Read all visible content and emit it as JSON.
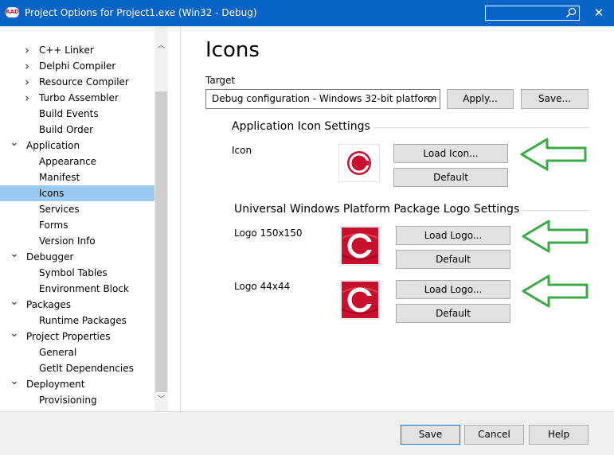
{
  "window": {
    "title": "Project Options for Project1.exe  (Win32 - Debug)",
    "app_badge": "RAD",
    "close_symbol": "✕"
  },
  "tree": {
    "items": [
      {
        "label": "C++ Linker",
        "level": 1,
        "expander": "collapsed"
      },
      {
        "label": "Delphi Compiler",
        "level": 1,
        "expander": "collapsed"
      },
      {
        "label": "Resource Compiler",
        "level": 1,
        "expander": "collapsed"
      },
      {
        "label": "Turbo Assembler",
        "level": 1,
        "expander": "collapsed"
      },
      {
        "label": "Build Events",
        "level": 1,
        "expander": "none"
      },
      {
        "label": "Build Order",
        "level": 1,
        "expander": "none"
      },
      {
        "label": "Application",
        "level": 0,
        "expander": "expanded"
      },
      {
        "label": "Appearance",
        "level": 1,
        "expander": "none"
      },
      {
        "label": "Manifest",
        "level": 1,
        "expander": "none"
      },
      {
        "label": "Icons",
        "level": 1,
        "expander": "none",
        "selected": true
      },
      {
        "label": "Services",
        "level": 1,
        "expander": "none"
      },
      {
        "label": "Forms",
        "level": 1,
        "expander": "none"
      },
      {
        "label": "Version Info",
        "level": 1,
        "expander": "none"
      },
      {
        "label": "Debugger",
        "level": 0,
        "expander": "expanded"
      },
      {
        "label": "Symbol Tables",
        "level": 1,
        "expander": "none"
      },
      {
        "label": "Environment Block",
        "level": 1,
        "expander": "none"
      },
      {
        "label": "Packages",
        "level": 0,
        "expander": "expanded"
      },
      {
        "label": "Runtime Packages",
        "level": 1,
        "expander": "none"
      },
      {
        "label": "Project Properties",
        "level": 0,
        "expander": "expanded"
      },
      {
        "label": "General",
        "level": 1,
        "expander": "none"
      },
      {
        "label": "GetIt Dependencies",
        "level": 1,
        "expander": "none"
      },
      {
        "label": "Deployment",
        "level": 0,
        "expander": "expanded"
      },
      {
        "label": "Provisioning",
        "level": 1,
        "expander": "none"
      }
    ]
  },
  "main": {
    "page_title": "Icons",
    "target_label": "Target",
    "target_value": "Debug configuration - Windows 32-bit platform",
    "apply_label": "Apply...",
    "save_label": "Save...",
    "app_icon_group": {
      "title": "Application Icon Settings",
      "icon_label": "Icon",
      "load_label": "Load Icon...",
      "default_label": "Default"
    },
    "uwp_group": {
      "title": "Universal Windows Platform Package Logo Settings",
      "logo150_label": "Logo 150x150",
      "logo44_label": "Logo 44x44",
      "load_label": "Load Logo...",
      "default_label": "Default"
    }
  },
  "footer": {
    "save": "Save",
    "cancel": "Cancel",
    "help": "Help"
  },
  "colors": {
    "titlebar": "#0a64c8",
    "selection": "#99c9ef",
    "arrow": "#3aaa49",
    "logo_red": "#c8102e"
  }
}
